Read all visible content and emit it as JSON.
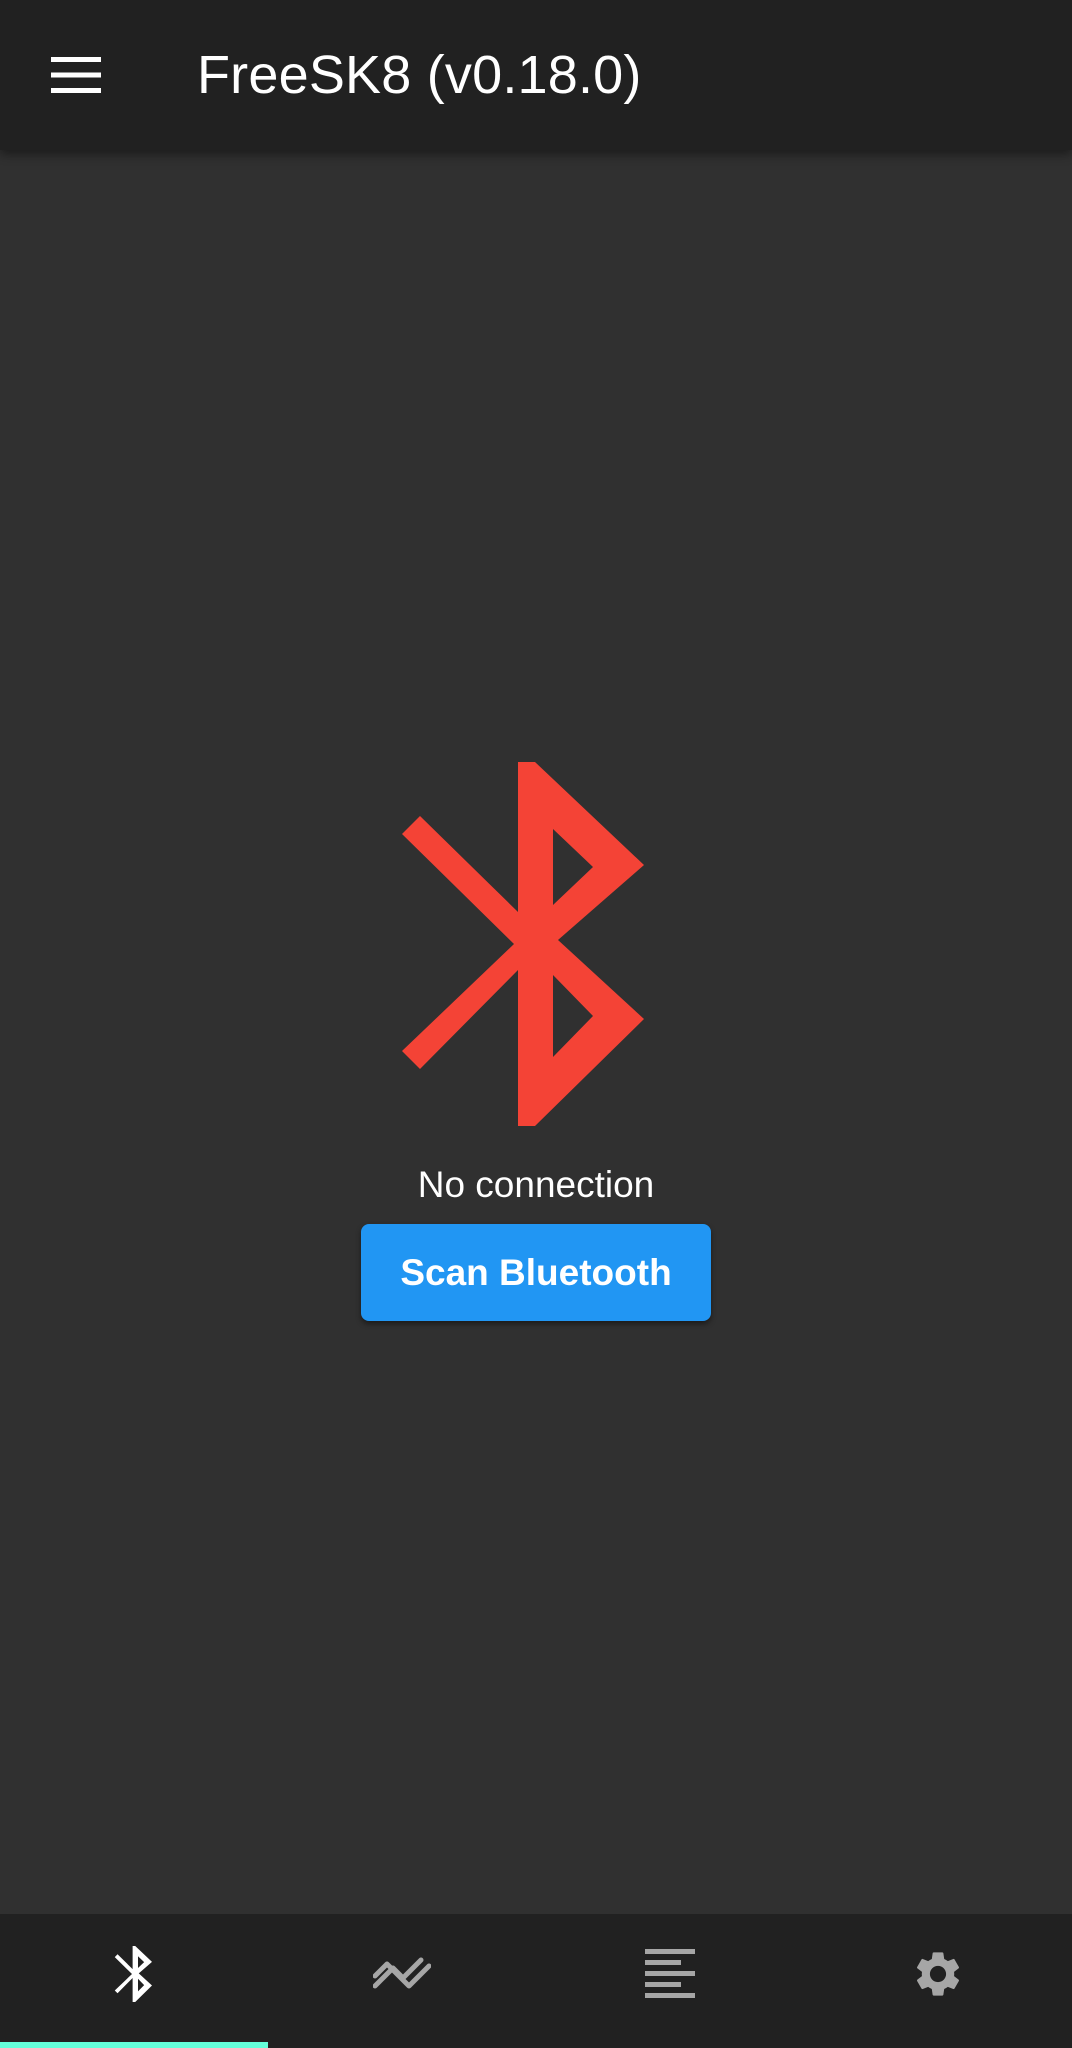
{
  "app_bar": {
    "title": "FreeSK8 (v0.18.0)",
    "menu_icon": "hamburger-menu-icon"
  },
  "connection": {
    "icon": "bluetooth-disabled-icon",
    "icon_color": "#f44336",
    "status_text": "No connection",
    "scan_button_label": "Scan Bluetooth",
    "scan_button_color": "#2196f3"
  },
  "bottom_nav": {
    "selected_index": 0,
    "indicator_color": "#64ffda",
    "tabs": [
      {
        "icon": "bluetooth-icon",
        "selected": true
      },
      {
        "icon": "trending-chart-icon",
        "selected": false
      },
      {
        "icon": "align-left-text-icon",
        "selected": false
      },
      {
        "icon": "gear-icon",
        "selected": false
      }
    ]
  },
  "colors": {
    "app_bar_bg": "#212121",
    "body_bg": "#303030",
    "nav_bg": "#212121",
    "inactive_icon": "#a6a6a6",
    "active_icon": "#ffffff"
  }
}
